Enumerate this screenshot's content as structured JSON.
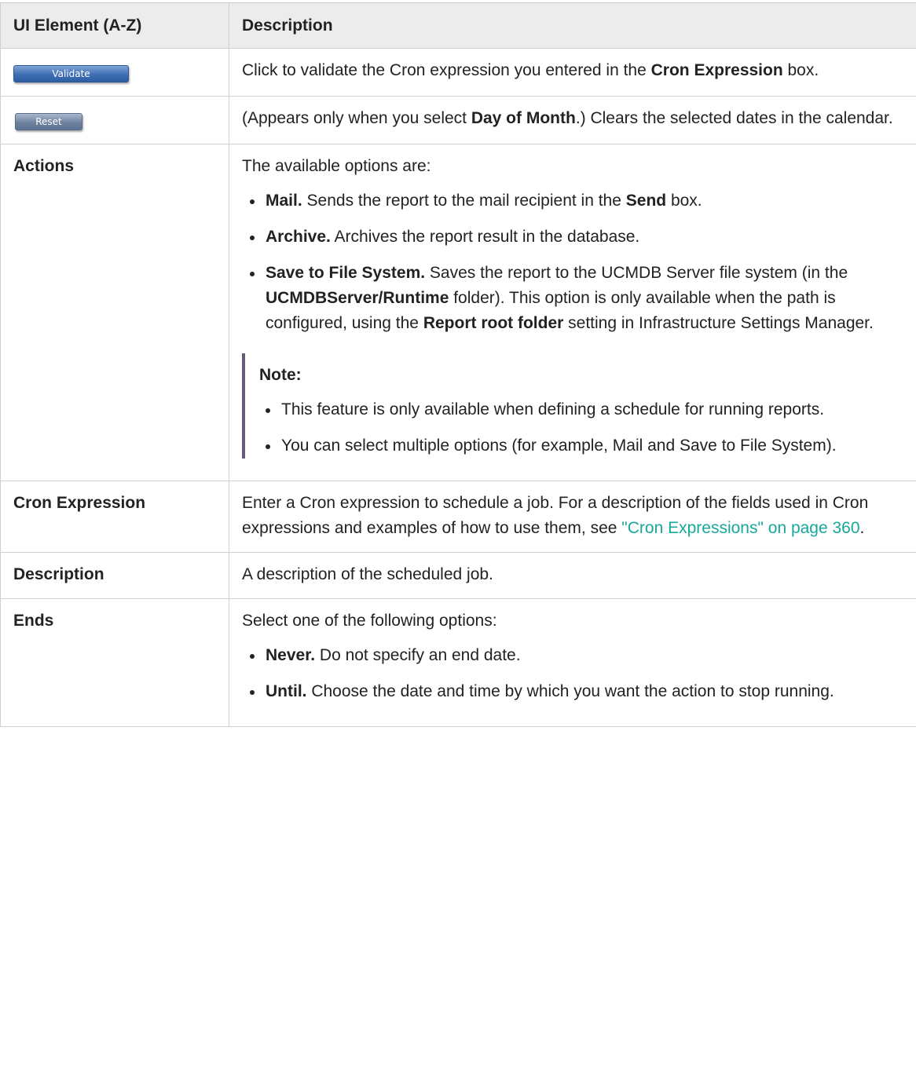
{
  "header": {
    "col1": "UI Element (A-Z)",
    "col2": "Description"
  },
  "rows": {
    "validate": {
      "button_label": "Validate",
      "desc_pre": "Click to validate the Cron expression you entered in the ",
      "desc_bold": "Cron Expression",
      "desc_post": " box."
    },
    "reset": {
      "button_label": "Reset",
      "desc_pre": "(Appears only when you select ",
      "desc_bold": "Day of Month",
      "desc_post": ".) Clears the selected dates in the calendar."
    },
    "actions": {
      "element": "Actions",
      "lead": "The available options are:",
      "items": [
        {
          "bold": "Mail.",
          "text_pre": " Sends the report to the mail recipient in the ",
          "bold2": "Send",
          "text_post": " box."
        },
        {
          "bold": "Archive.",
          "text": " Archives the report result in the database."
        },
        {
          "bold": "Save to File System.",
          "text_pre": " Saves the report to the UCMDB Server file system (in the ",
          "bold2": "UCMDBServer/Runtime",
          "text_mid": " folder). This option is only available when the path is configured, using the ",
          "bold3": "Report root folder",
          "text_post": " setting in Infrastructure Settings Manager."
        }
      ],
      "note": {
        "title": "Note:",
        "items": [
          "This feature is only available when defining a schedule for running reports.",
          "You can select multiple options (for example, Mail and Save to File System)."
        ]
      }
    },
    "cron": {
      "element": "Cron Expression",
      "desc_pre": "Enter a Cron expression to schedule a job. For a description of the fields used in Cron expressions and examples of how to use them, see ",
      "link": "\"Cron Expressions\" on page 360",
      "desc_post": "."
    },
    "description": {
      "element": "Description",
      "desc": "A description of the scheduled job."
    },
    "ends": {
      "element": "Ends",
      "lead": "Select one of the following options:",
      "items": [
        {
          "bold": "Never.",
          "text": " Do not specify an end date."
        },
        {
          "bold": "Until.",
          "text": " Choose the date and time by which you want the action to stop running."
        }
      ]
    }
  },
  "colors": {
    "header_bg": "#ececec",
    "border": "#cfcfcf",
    "link": "#16a89a",
    "note_bar": "#6a5a7a",
    "validate_button": "#3f6fb3",
    "reset_button": "#6f83a1"
  }
}
